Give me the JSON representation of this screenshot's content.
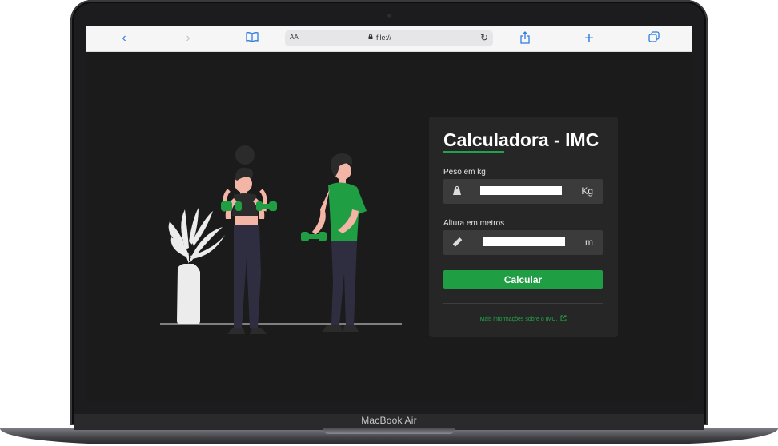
{
  "device": {
    "label": "MacBook Air"
  },
  "browser": {
    "reader_label": "AA",
    "url": "file://",
    "icons": [
      "back-icon",
      "forward-icon",
      "bookmarks-icon",
      "lock-icon",
      "reload-icon",
      "share-icon",
      "new-tab-icon",
      "tabs-icon"
    ]
  },
  "calculator": {
    "title": "Calculadora - IMC",
    "weight_label": "Peso em kg",
    "weight_value": "",
    "weight_unit": "Kg",
    "height_label": "Altura em metros",
    "height_value": "",
    "height_unit": "m",
    "submit_label": "Calcular",
    "more_info_label": "Mais informações sobre o IMC."
  },
  "colors": {
    "accent": "#1f9e43",
    "background": "#1b1b1c",
    "card": "#262627",
    "browser_blue": "#2f7de0"
  }
}
